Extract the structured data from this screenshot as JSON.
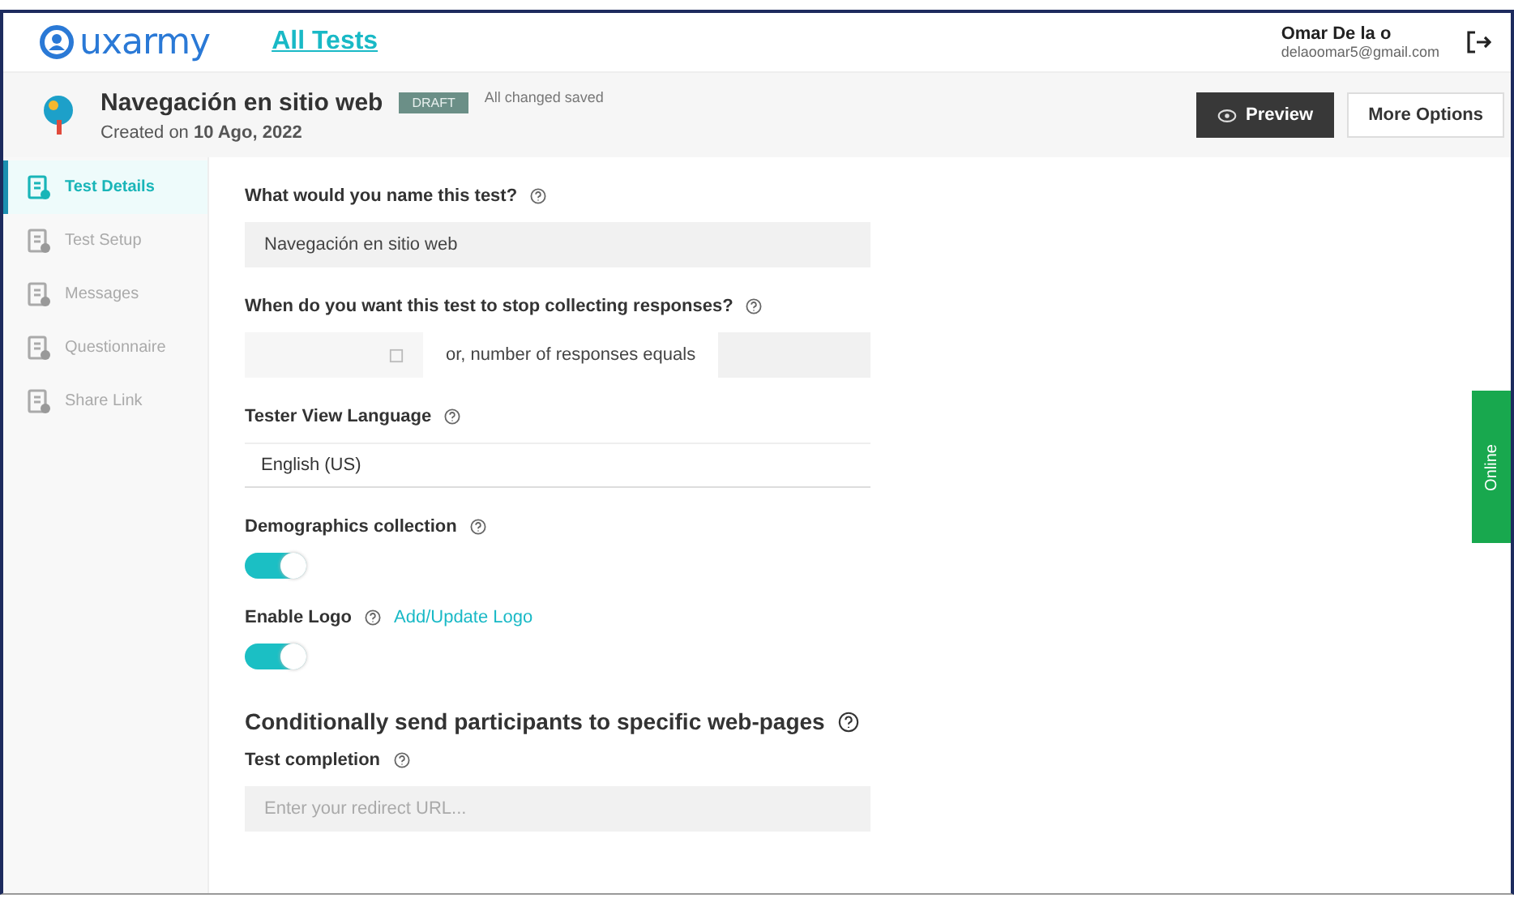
{
  "header": {
    "logo": "uxarmy",
    "nav_link": "All Tests",
    "user": {
      "name": "Omar De la o",
      "email": "delaoomar5@gmail.com"
    }
  },
  "test": {
    "title": "Navegación en sitio web",
    "status": "DRAFT",
    "save_status": "All changed saved",
    "created": "Created on **10 Ago, 2022**",
    "buttons": [
      {
        "label": "Preview",
        "kind": "primary"
      },
      {
        "label": "More Options",
        "kind": "secondary"
      }
    ]
  },
  "sidebar": {
    "items": [
      {
        "label": "Test Details",
        "selected": true
      },
      {
        "label": "Test Setup",
        "selected": false
      },
      {
        "label": "Messages",
        "selected": false
      },
      {
        "label": "Questionnaire",
        "selected": false
      },
      {
        "label": "Share Link",
        "selected": false
      }
    ]
  },
  "form": {
    "name_label": "What would you name this test?",
    "name_value": "Navegación en sitio web",
    "stop_label": "When do you want this test to stop collecting responses?",
    "responses_label": "or, number of responses equals",
    "language_label": "Tester View Language",
    "language_value": "English (US)",
    "demographics_label": "Demographics collection",
    "demographics_on": true,
    "logo_label": "Enable Logo",
    "logo_link": "Add/Update Logo",
    "logo_on": true,
    "redirect_heading": "Conditionally send participants to specific web-pages",
    "completion_label": "Test completion",
    "completion_placeholder": "Enter your redirect URL..."
  },
  "online_tab": "Online"
}
